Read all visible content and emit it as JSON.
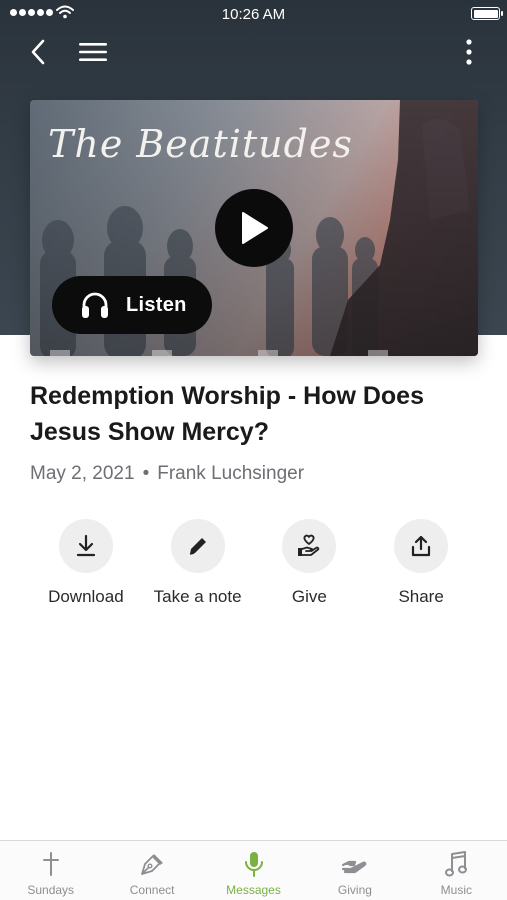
{
  "status_bar": {
    "time": "10:26 AM"
  },
  "video": {
    "overlay_title": "The Beatitudes",
    "listen_label": "Listen"
  },
  "sermon": {
    "title": "Redemption Worship - How Does Jesus Show Mercy?",
    "date": "May 2, 2021",
    "separator": "•",
    "speaker": "Frank Luchsinger"
  },
  "actions": [
    {
      "label": "Download",
      "icon": "download-icon"
    },
    {
      "label": "Take a note",
      "icon": "pencil-icon"
    },
    {
      "label": "Give",
      "icon": "give-hand-heart-icon"
    },
    {
      "label": "Share",
      "icon": "share-icon"
    }
  ],
  "tabs": [
    {
      "label": "Sundays",
      "icon": "cross-icon",
      "active": false
    },
    {
      "label": "Connect",
      "icon": "pen-nib-icon",
      "active": false
    },
    {
      "label": "Messages",
      "icon": "microphone-icon",
      "active": true
    },
    {
      "label": "Giving",
      "icon": "giving-hand-icon",
      "active": false
    },
    {
      "label": "Music",
      "icon": "music-note-icon",
      "active": false
    }
  ],
  "colors": {
    "accent": "#7ab142",
    "header_bg": "#2f3942",
    "tab_inactive": "#8e8e93"
  }
}
